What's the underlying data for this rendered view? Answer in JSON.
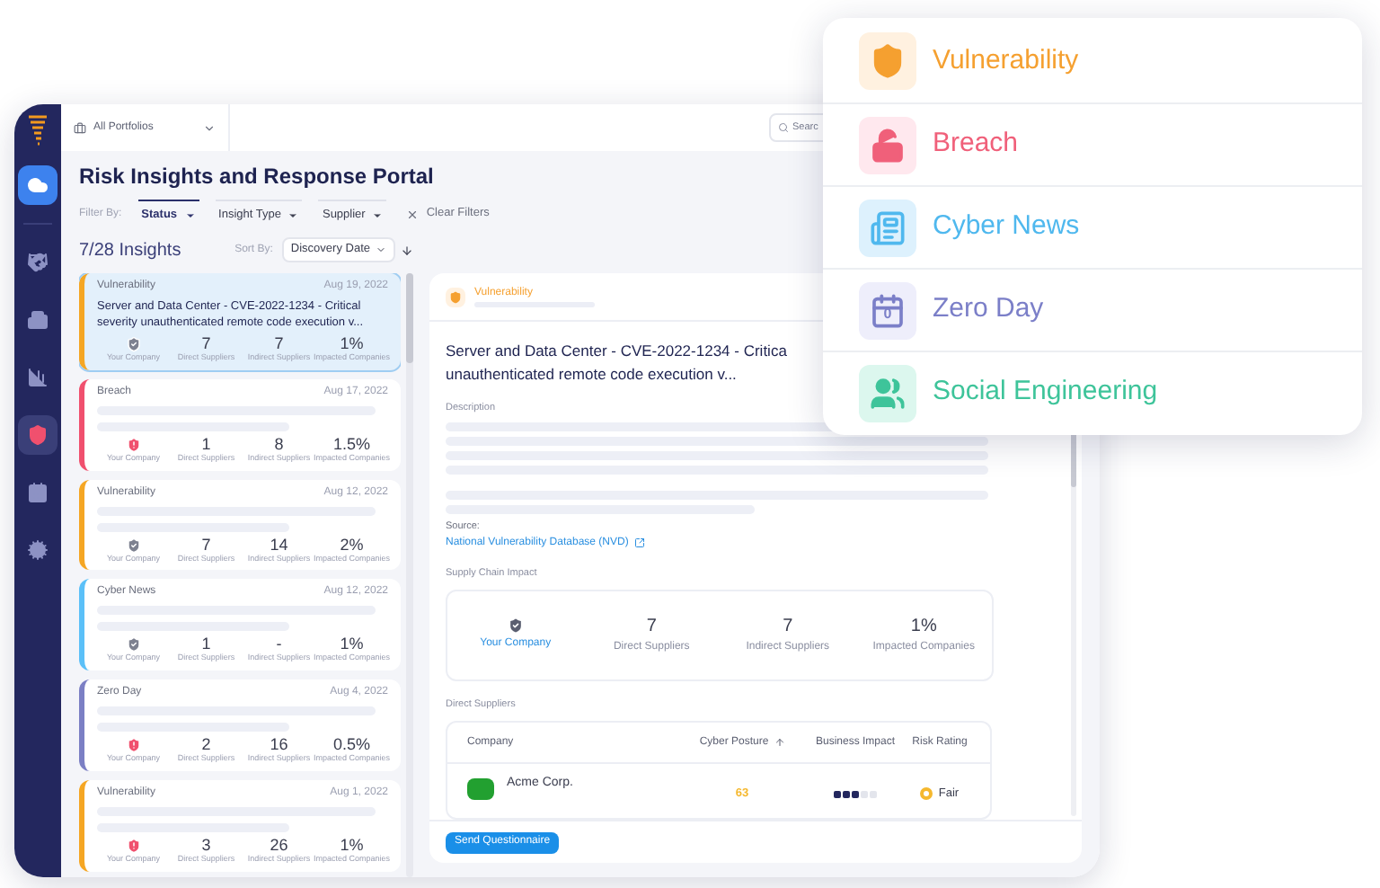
{
  "sidebar": {
    "items": [
      {
        "selected": false
      },
      {
        "selected": false
      },
      {
        "selected": false
      },
      {
        "selected": true
      },
      {
        "selected": false
      },
      {
        "selected": false
      }
    ]
  },
  "top_bar": {
    "portfolio": "All Portfolios",
    "search": {
      "placeholder": "Searc"
    }
  },
  "title": "Risk Insights and Response Portal",
  "filters": {
    "label": "Filter By:",
    "items": [
      {
        "label": "Status",
        "selected": true
      },
      {
        "label": "Insight Type",
        "selected": false
      },
      {
        "label": "Supplier",
        "selected": false
      }
    ],
    "clear": "Clear Filters"
  },
  "list_header": {
    "count": "7/28 Insights",
    "sort_label": "Sort By:",
    "sort_value": "Discovery Date"
  },
  "cards": [
    {
      "category": "Vulnerability",
      "color": "#f5a623",
      "date": "Aug 19, 2022",
      "selected": true,
      "title": "Server and Data Center - CVE-2022-1234 - Critical severity unauthenticated remote code execution v...",
      "company_alert": false,
      "company": "Your Company",
      "stats": [
        {
          "value": "7",
          "label": "Direct Suppliers"
        },
        {
          "value": "7",
          "label": "Indirect Suppliers"
        },
        {
          "value": "1%",
          "label": "Impacted Companies"
        }
      ]
    },
    {
      "category": "Breach",
      "color": "#f0506e",
      "date": "Aug 17, 2022",
      "selected": false,
      "company_alert": true,
      "company": "Your Company",
      "stats": [
        {
          "value": "1",
          "label": "Direct Suppliers"
        },
        {
          "value": "8",
          "label": "Indirect Suppliers"
        },
        {
          "value": "1.5%",
          "label": "Impacted Companies"
        }
      ]
    },
    {
      "category": "Vulnerability",
      "color": "#f5a623",
      "date": "Aug 12, 2022",
      "selected": false,
      "company_alert": false,
      "company": "Your Company",
      "stats": [
        {
          "value": "7",
          "label": "Direct Suppliers"
        },
        {
          "value": "14",
          "label": "Indirect Suppliers"
        },
        {
          "value": "2%",
          "label": "Impacted Companies"
        }
      ]
    },
    {
      "category": "Cyber News",
      "color": "#5bc0f8",
      "date": "Aug 12, 2022",
      "selected": false,
      "company_alert": false,
      "company": "Your Company",
      "stats": [
        {
          "value": "1",
          "label": "Direct Suppliers"
        },
        {
          "value": "-",
          "label": "Indirect Suppliers"
        },
        {
          "value": "1%",
          "label": "Impacted Companies"
        }
      ]
    },
    {
      "category": "Zero Day",
      "color": "#7b7fc4",
      "date": "Aug 4, 2022",
      "selected": false,
      "company_alert": true,
      "company": "Your Company",
      "stats": [
        {
          "value": "2",
          "label": "Direct Suppliers"
        },
        {
          "value": "16",
          "label": "Indirect Suppliers"
        },
        {
          "value": "0.5%",
          "label": "Impacted Companies"
        }
      ]
    },
    {
      "category": "Vulnerability",
      "color": "#f5a623",
      "date": "Aug 1, 2022",
      "selected": false,
      "company_alert": true,
      "company": "Your Company",
      "stats": [
        {
          "value": "3",
          "label": "Direct Suppliers"
        },
        {
          "value": "26",
          "label": "Indirect Suppliers"
        },
        {
          "value": "1%",
          "label": "Impacted Companies"
        }
      ]
    }
  ],
  "detail": {
    "category": "Vulnerability",
    "title_lines": [
      "Server and Data Center - CVE-2022-1234 - Critica",
      "unauthenticated remote code execution v..."
    ],
    "description_label": "Description",
    "source_label": "Source:",
    "source_link": "National Vulnerability Database (NVD)",
    "impact": {
      "label": "Supply Chain Impact",
      "company": "Your Company",
      "stats": [
        {
          "value": "7",
          "label": "Direct Suppliers"
        },
        {
          "value": "7",
          "label": "Indirect Suppliers"
        },
        {
          "value": "1%",
          "label": "Impacted Companies"
        }
      ]
    },
    "suppliers": {
      "label": "Direct Suppliers",
      "columns": [
        "Company",
        "Cyber Posture",
        "Business Impact",
        "Risk Rating"
      ],
      "rows": [
        {
          "company": "Acme Corp.",
          "posture": "63",
          "stars": 3,
          "rating": "Fair"
        }
      ]
    },
    "button": "Send Questionnaire"
  },
  "insight_types": [
    {
      "kind": "vulnerability",
      "label": "Vulnerability",
      "color": "#f5a030"
    },
    {
      "kind": "breach",
      "label": "Breach",
      "color": "#f0607a"
    },
    {
      "kind": "news",
      "label": "Cyber News",
      "color": "#4fb8ee"
    },
    {
      "kind": "zeroday",
      "label": "Zero Day",
      "color": "#7b7fc8",
      "badge": "0"
    },
    {
      "kind": "social",
      "label": "Social Engineering",
      "color": "#3ec49a"
    }
  ]
}
